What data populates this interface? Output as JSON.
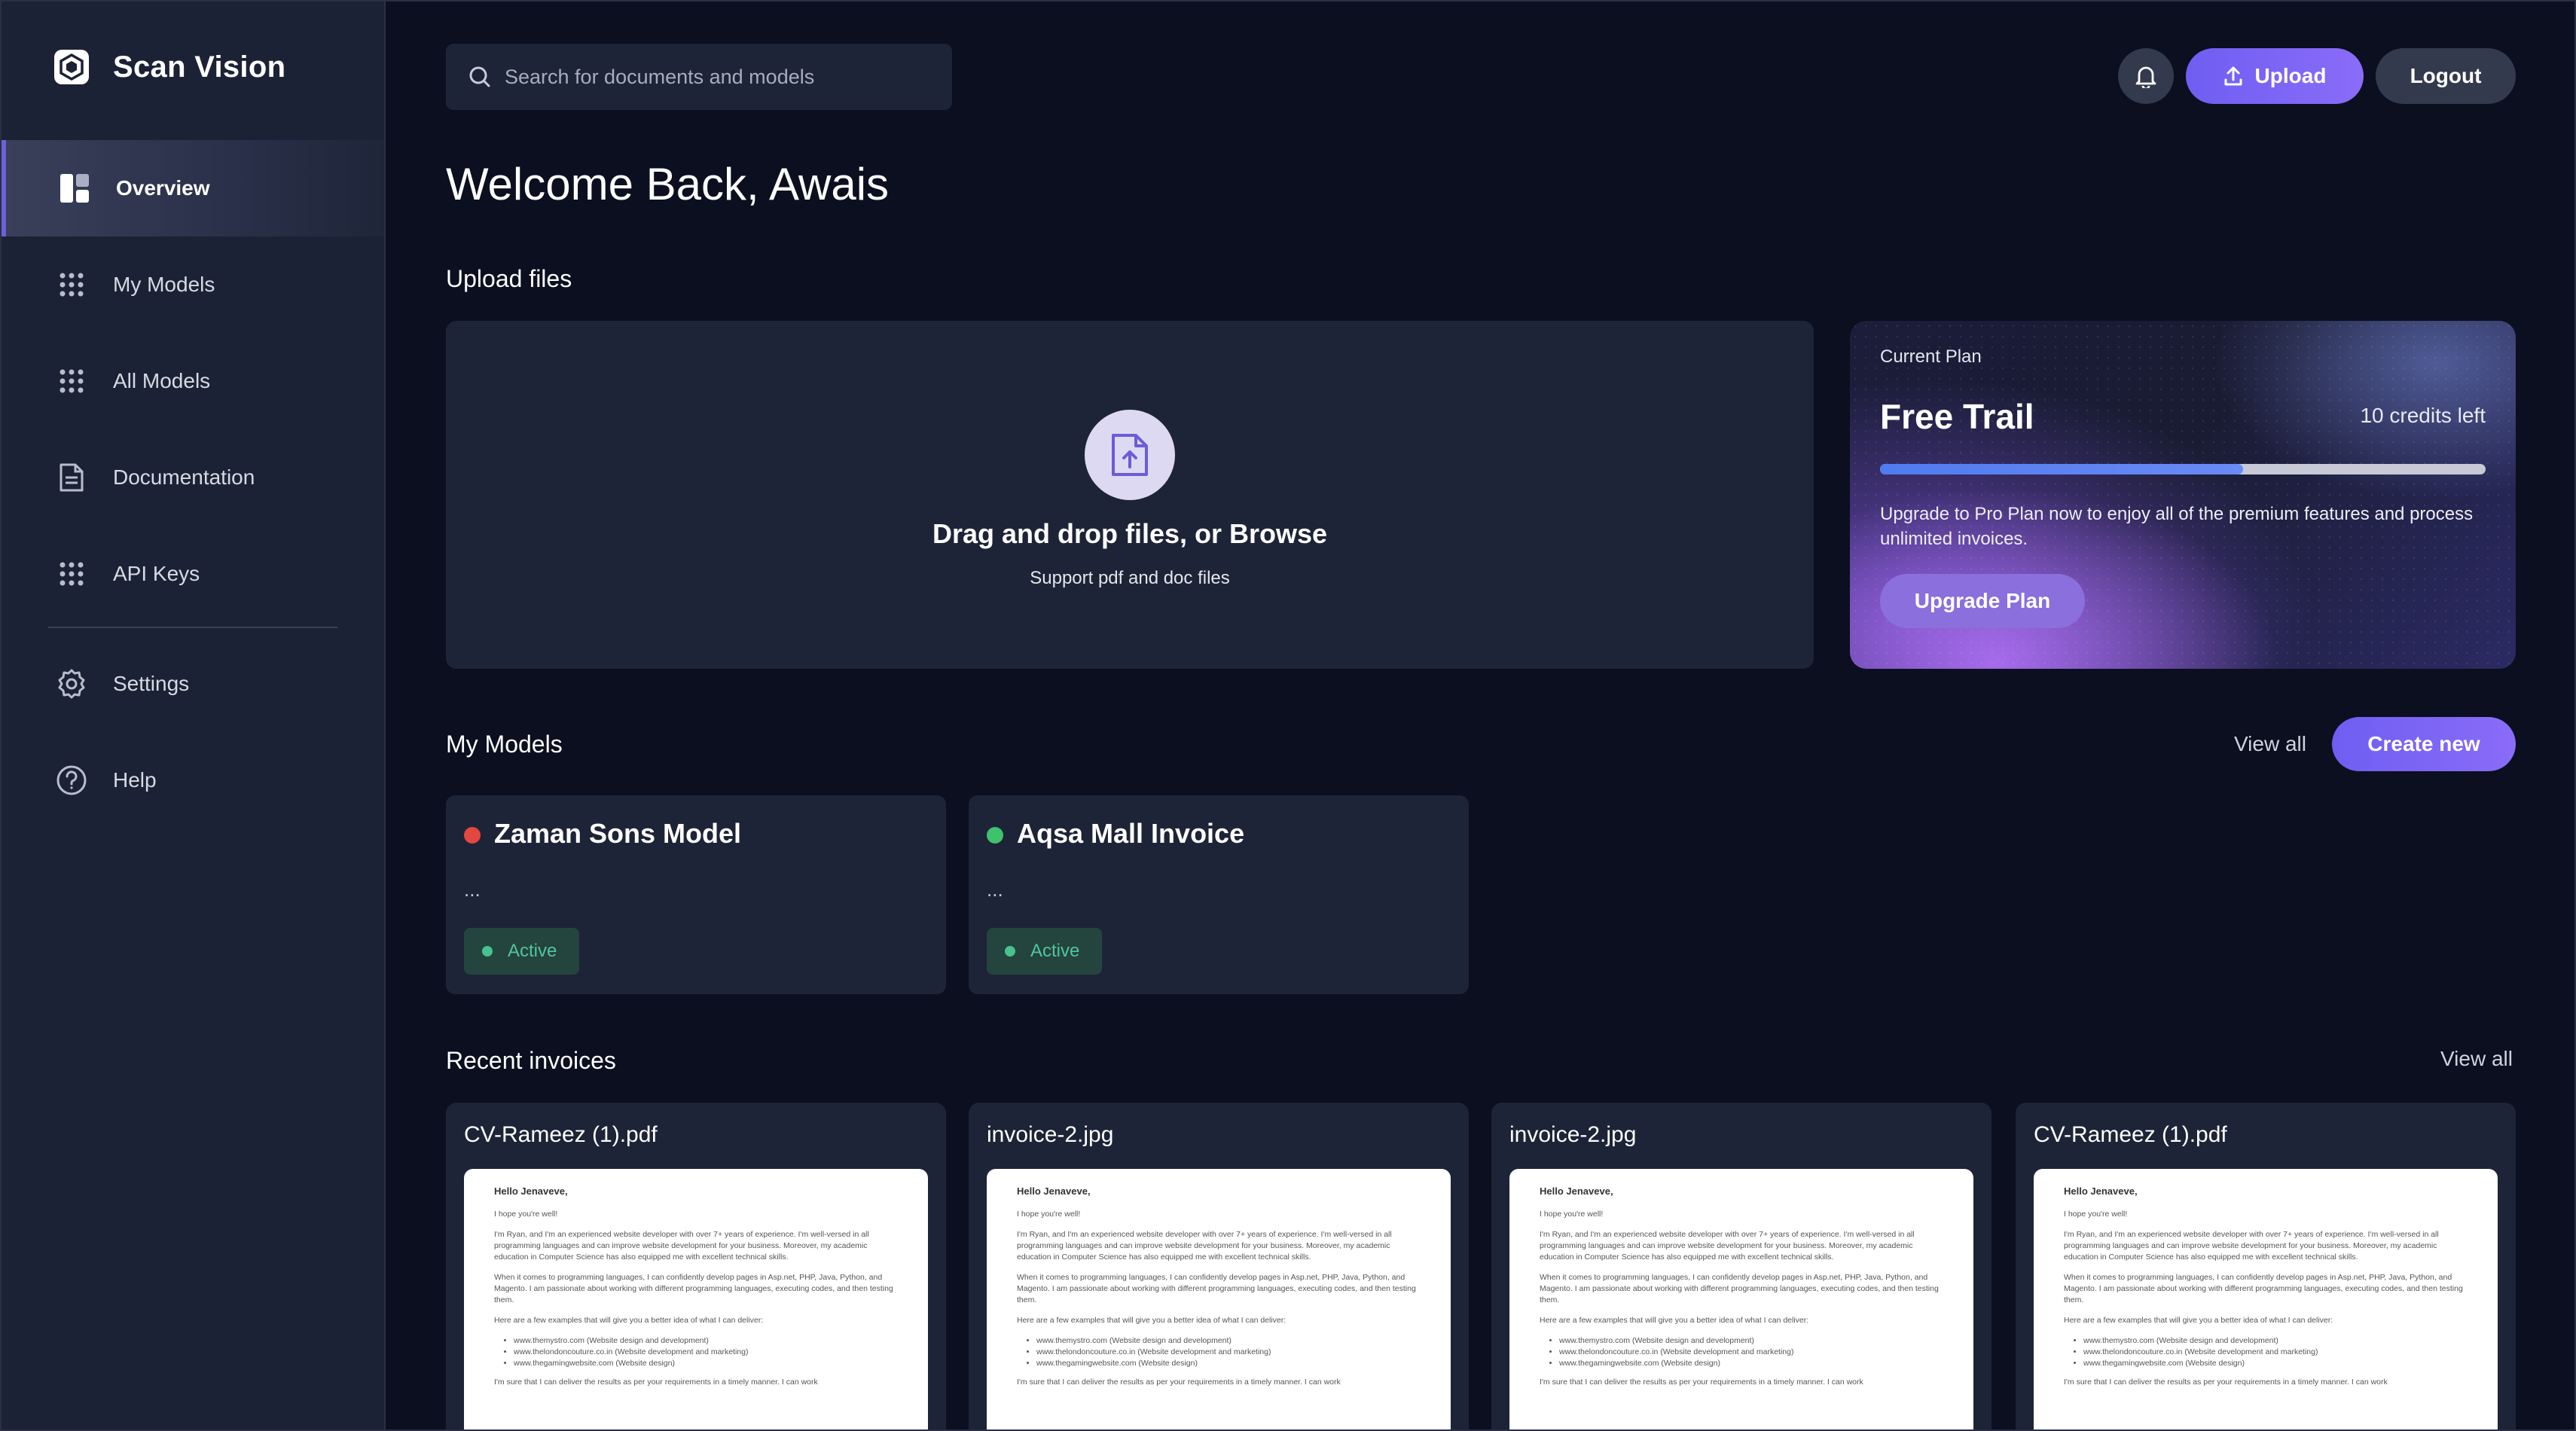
{
  "app": {
    "name": "Scan Vision"
  },
  "sidebar": {
    "items": [
      {
        "label": "Overview"
      },
      {
        "label": "My Models"
      },
      {
        "label": "All Models"
      },
      {
        "label": "Documentation"
      },
      {
        "label": "API Keys"
      },
      {
        "label": "Settings"
      },
      {
        "label": "Help"
      }
    ]
  },
  "header": {
    "search_placeholder": "Search for documents and models",
    "upload_label": "Upload",
    "logout_label": "Logout"
  },
  "welcome": "Welcome Back, Awais",
  "upload": {
    "section_title": "Upload files",
    "title": "Drag and drop files, or Browse",
    "subtitle": "Support pdf and doc files"
  },
  "plan": {
    "label": "Current Plan",
    "name": "Free Trail",
    "credits": "10 credits left",
    "usage_fraction": 0.6,
    "description": "Upgrade to Pro Plan now to enjoy all of the premium features and process unlimited invoices.",
    "button": "Upgrade Plan"
  },
  "models": {
    "section_title": "My Models",
    "view_all": "View all",
    "create_label": "Create new",
    "cards": [
      {
        "title": "Zaman Sons Model",
        "desc": "...",
        "status": "Active",
        "dot_color": "#e2483f"
      },
      {
        "title": "Aqsa Mall Invoice",
        "desc": "...",
        "status": "Active",
        "dot_color": "#3fc26b"
      }
    ]
  },
  "invoices": {
    "section_title": "Recent invoices",
    "view_all": "View all",
    "cards": [
      {
        "name": "CV-Rameez (1).pdf"
      },
      {
        "name": "invoice-2.jpg"
      },
      {
        "name": "invoice-2.jpg"
      },
      {
        "name": "CV-Rameez (1).pdf"
      }
    ],
    "preview": {
      "greeting": "Hello Jenaveve,",
      "line1": "I hope you're well!",
      "para1": "I'm Ryan, and I'm an experienced website developer with over 7+ years of experience. I'm well-versed in all programming languages and can improve website development for your business. Moreover, my academic education in Computer Science has also equipped me with excellent technical skills.",
      "para2": "When it comes to programming languages, I can confidently develop pages in Asp.net, PHP, Java, Python, and Magento. I am passionate about working with different programming languages, executing codes, and then testing them.",
      "para3": "Here are a few examples that will give you a better idea of what I can deliver:",
      "bullets": [
        "www.themystro.com (Website design and development)",
        "www.thelondoncouture.co.in (Website development and marketing)",
        "www.thegamingwebsite.com (Website design)"
      ],
      "closing": "I'm sure that I can deliver the results as per your requirements in a timely manner. I can work"
    }
  }
}
